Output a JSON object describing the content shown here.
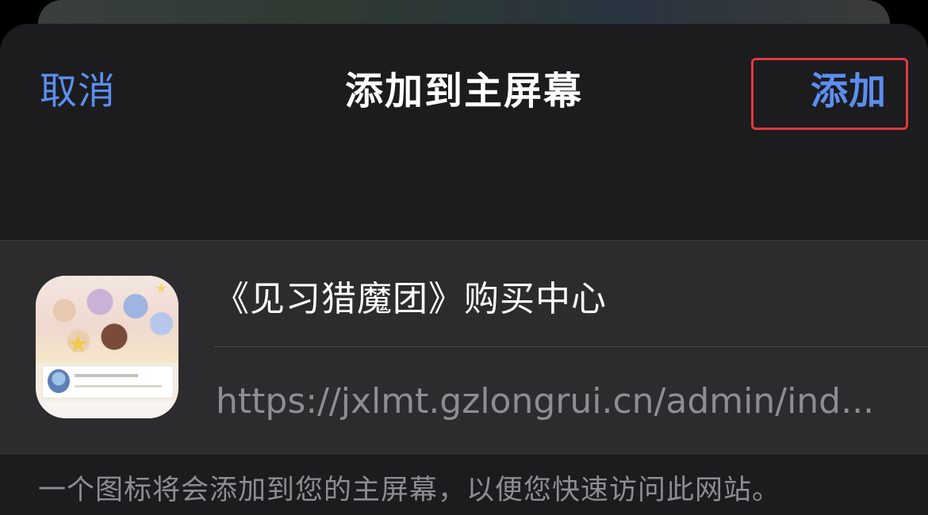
{
  "nav": {
    "cancel_label": "取消",
    "title": "添加到主屏幕",
    "add_label": "添加"
  },
  "bookmark": {
    "icon": "app-icon",
    "name": "《见习猎魔团》购买中心",
    "url": "https://jxlmt.gzlongrui.cn/admin/ind..."
  },
  "footer": {
    "note": "一个图标将会添加到您的主屏幕，以便您快速访问此网站。"
  },
  "colors": {
    "accent": "#5b8ef0",
    "highlight": "#e0393e",
    "sheet_bg": "#1c1c1e",
    "group_bg": "#2c2c2e"
  }
}
